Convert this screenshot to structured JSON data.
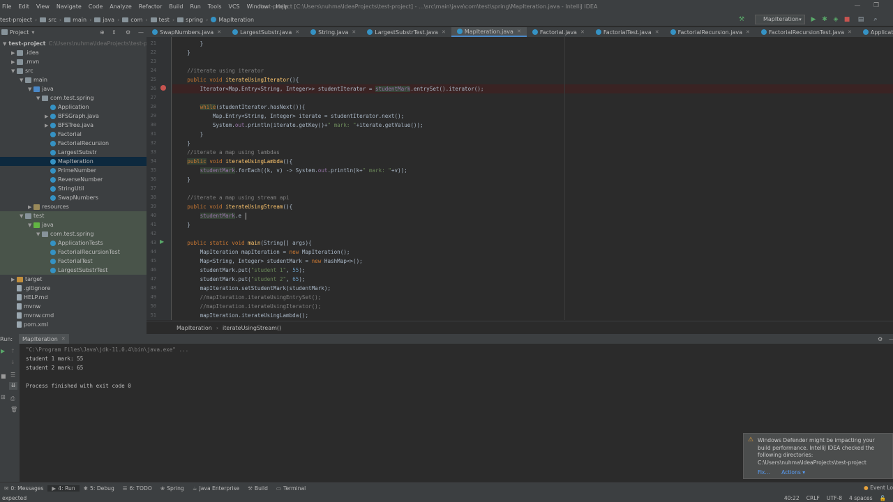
{
  "menu": [
    "File",
    "Edit",
    "View",
    "Navigate",
    "Code",
    "Analyze",
    "Refactor",
    "Build",
    "Run",
    "Tools",
    "VCS",
    "Window",
    "Help"
  ],
  "window_title": "test-project [C:\\Users\\nuhma\\IdeaProjects\\test-project] - ...\\src\\main\\java\\com\\test\\spring\\MapIteration.java - IntelliJ IDEA",
  "breadcrumbs": [
    "test-project",
    "src",
    "main",
    "java",
    "com",
    "test",
    "spring",
    "MapIteration"
  ],
  "run_config": "MapIteration",
  "project_panel": {
    "title": "Project",
    "tree": [
      {
        "label": "test-project",
        "hint": "C:\\Users\\nuhma\\IdeaProjects\\test-projec",
        "icon": "folder",
        "depth": 0,
        "open": true
      },
      {
        "label": ".idea",
        "icon": "folder",
        "depth": 1,
        "open": false
      },
      {
        "label": ".mvn",
        "icon": "folder",
        "depth": 1,
        "open": false
      },
      {
        "label": "src",
        "icon": "folder",
        "depth": 1,
        "open": true
      },
      {
        "label": "main",
        "icon": "folder",
        "depth": 2,
        "open": true
      },
      {
        "label": "java",
        "icon": "src",
        "depth": 3,
        "open": true
      },
      {
        "label": "com.test.spring",
        "icon": "folder",
        "depth": 4,
        "open": true
      },
      {
        "label": "Application",
        "icon": "cls",
        "depth": 5
      },
      {
        "label": "BFSGraph.java",
        "icon": "cls",
        "depth": 5,
        "open": false
      },
      {
        "label": "BFSTree.java",
        "icon": "cls",
        "depth": 5,
        "open": false
      },
      {
        "label": "Factorial",
        "icon": "cls",
        "depth": 5
      },
      {
        "label": "FactorialRecursion",
        "icon": "cls",
        "depth": 5
      },
      {
        "label": "LargestSubstr",
        "icon": "cls",
        "depth": 5
      },
      {
        "label": "MapIteration",
        "icon": "cls",
        "depth": 5,
        "selected": true
      },
      {
        "label": "PrimeNumber",
        "icon": "cls",
        "depth": 5
      },
      {
        "label": "ReverseNumber",
        "icon": "cls",
        "depth": 5
      },
      {
        "label": "StringUtil",
        "icon": "cls",
        "depth": 5
      },
      {
        "label": "SwapNumbers",
        "icon": "cls",
        "depth": 5
      },
      {
        "label": "resources",
        "icon": "res",
        "depth": 3,
        "open": false
      },
      {
        "label": "test",
        "icon": "folder",
        "depth": 2,
        "open": true,
        "test": true
      },
      {
        "label": "java",
        "icon": "testsrc",
        "depth": 3,
        "open": true,
        "test": true
      },
      {
        "label": "com.test.spring",
        "icon": "folder",
        "depth": 4,
        "open": true,
        "test": true
      },
      {
        "label": "ApplicationTests",
        "icon": "cls",
        "depth": 5,
        "test": true
      },
      {
        "label": "FactorialRecursionTest",
        "icon": "cls",
        "depth": 5,
        "test": true
      },
      {
        "label": "FactorialTest",
        "icon": "cls",
        "depth": 5,
        "test": true
      },
      {
        "label": "LargestSubstrTest",
        "icon": "cls",
        "depth": 5,
        "test": true
      },
      {
        "label": "target",
        "icon": "tgt",
        "depth": 1,
        "open": false
      },
      {
        "label": ".gitignore",
        "icon": "file",
        "depth": 1
      },
      {
        "label": "HELP.md",
        "icon": "file",
        "depth": 1
      },
      {
        "label": "mvnw",
        "icon": "file",
        "depth": 1
      },
      {
        "label": "mvnw.cmd",
        "icon": "file",
        "depth": 1
      },
      {
        "label": "pom.xml",
        "icon": "file",
        "depth": 1
      }
    ]
  },
  "editor_tabs": [
    {
      "label": "SwapNumbers.java"
    },
    {
      "label": "LargestSubstr.java"
    },
    {
      "label": "String.java"
    },
    {
      "label": "LargestSubstrTest.java"
    },
    {
      "label": "MapIteration.java",
      "active": true
    },
    {
      "label": "Factorial.java"
    },
    {
      "label": "FactorialTest.java"
    },
    {
      "label": "FactorialRecursion.java"
    },
    {
      "label": "FactorialRecursionTest.java"
    },
    {
      "label": "ApplicationTests.java"
    }
  ],
  "code_lines": [
    {
      "n": "21",
      "html": "        }"
    },
    {
      "n": "22",
      "html": "    }"
    },
    {
      "n": "23",
      "html": ""
    },
    {
      "n": "24",
      "html": "    <span class=\"cm\">//iterate using iterator</span>"
    },
    {
      "n": "25",
      "html": "    <span class=\"kw\">public void</span> <span class=\"fn\">iterateUsingIterator</span>(){"
    },
    {
      "n": "26",
      "html": "        Iterator&lt;Map.Entry&lt;String, Integer&gt;&gt; studentIterator = <span class=\"fld hlw\">studentMark</span>.entrySet().iterator();",
      "bp": true
    },
    {
      "n": "27",
      "html": ""
    },
    {
      "n": "28",
      "html": "        <span class=\"kw hlw\">while</span>(studentIterator.hasNext()){"
    },
    {
      "n": "29",
      "html": "            Map.Entry&lt;String, Integer&gt; iterate = studentIterator.next();"
    },
    {
      "n": "30",
      "html": "            System.<span class=\"fld\">out</span>.println(iterate.getKey()+<span class=\"str\">\" mark: \"</span>+iterate.getValue());"
    },
    {
      "n": "31",
      "html": "        }"
    },
    {
      "n": "32",
      "html": "    }"
    },
    {
      "n": "33",
      "html": "    <span class=\"cm\">//iterate a map using lambdas</span>"
    },
    {
      "n": "34",
      "html": "    <span class=\"kw hlw\">public</span> <span class=\"kw\">void</span> <span class=\"fn\">iterateUsingLambda</span>(){"
    },
    {
      "n": "35",
      "html": "        <span class=\"fld hlw\">studentMark</span>.forEach((k, v) -&gt; System.<span class=\"fld\">out</span>.println(k+<span class=\"str\">\" mark: \"</span>+v));"
    },
    {
      "n": "36",
      "html": "    }"
    },
    {
      "n": "37",
      "html": ""
    },
    {
      "n": "38",
      "html": "    <span class=\"cm\">//iterate a map using stream api</span>"
    },
    {
      "n": "39",
      "html": "    <span class=\"kw\">public void</span> <span class=\"fn\">iterateUsingStream</span>(){"
    },
    {
      "n": "40",
      "html": "        <span class=\"fld hlw\">studentMark</span>.e"
    },
    {
      "n": "41",
      "html": "    }"
    },
    {
      "n": "42",
      "html": ""
    },
    {
      "n": "43",
      "html": "    <span class=\"kw\">public static void</span> <span class=\"fn\">main</span>(String[] args){"
    },
    {
      "n": "44",
      "html": "        MapIteration mapIteration = <span class=\"kw\">new</span> MapIteration();"
    },
    {
      "n": "45",
      "html": "        Map&lt;String, Integer&gt; studentMark = <span class=\"kw\">new</span> HashMap&lt;&gt;();"
    },
    {
      "n": "46",
      "html": "        studentMark.put(<span class=\"str\">\"student 1\"</span>, <span class=\"num\">55</span>);"
    },
    {
      "n": "47",
      "html": "        studentMark.put(<span class=\"str\">\"student 2\"</span>, <span class=\"num\">65</span>);"
    },
    {
      "n": "48",
      "html": "        mapIteration.setStudentMark(studentMark);"
    },
    {
      "n": "49",
      "html": "        <span class=\"cm\">//mapIteration.iterateUsingEntrySet();</span>"
    },
    {
      "n": "50",
      "html": "        <span class=\"cm\">//mapIteration.iterateUsingIterator();</span>"
    },
    {
      "n": "51",
      "html": "        mapIteration.iterateUsingLambda();"
    }
  ],
  "editor_breadcrumbs": [
    "MapIteration",
    "iterateUsingStream()"
  ],
  "run_panel": {
    "side_label": "Run:",
    "tab": "MapIteration",
    "console": [
      {
        "text": "\"C:\\Program Files\\Java\\jdk-11.0.4\\bin\\java.exe\" ...",
        "cmd": true
      },
      {
        "text": "student 1 mark: 55"
      },
      {
        "text": "student 2 mark: 65"
      },
      {
        "text": ""
      },
      {
        "text": "Process finished with exit code 0"
      }
    ]
  },
  "notification": {
    "text": "Windows Defender might be impacting your build performance. IntelliJ IDEA checked the following directories:",
    "path": "C:\\Users\\nuhma\\IdeaProjects\\test-project",
    "fix": "Fix...",
    "actions": "Actions ▾"
  },
  "bottom_tools": [
    {
      "label": "0: Messages",
      "icon": "✉"
    },
    {
      "label": "4: Run",
      "icon": "▶",
      "active": true
    },
    {
      "label": "5: Debug",
      "icon": "✱"
    },
    {
      "label": "6: TODO",
      "icon": "☰"
    },
    {
      "label": "Spring",
      "icon": "❀"
    },
    {
      "label": "Java Enterprise",
      "icon": "☕"
    },
    {
      "label": "Build",
      "icon": "⚒"
    },
    {
      "label": "Terminal",
      "icon": "▭"
    }
  ],
  "event_log": "Event Log",
  "status": {
    "left": "expected",
    "position": "40:22",
    "line_sep": "CRLF",
    "encoding": "UTF-8",
    "indent": "4 spaces"
  }
}
